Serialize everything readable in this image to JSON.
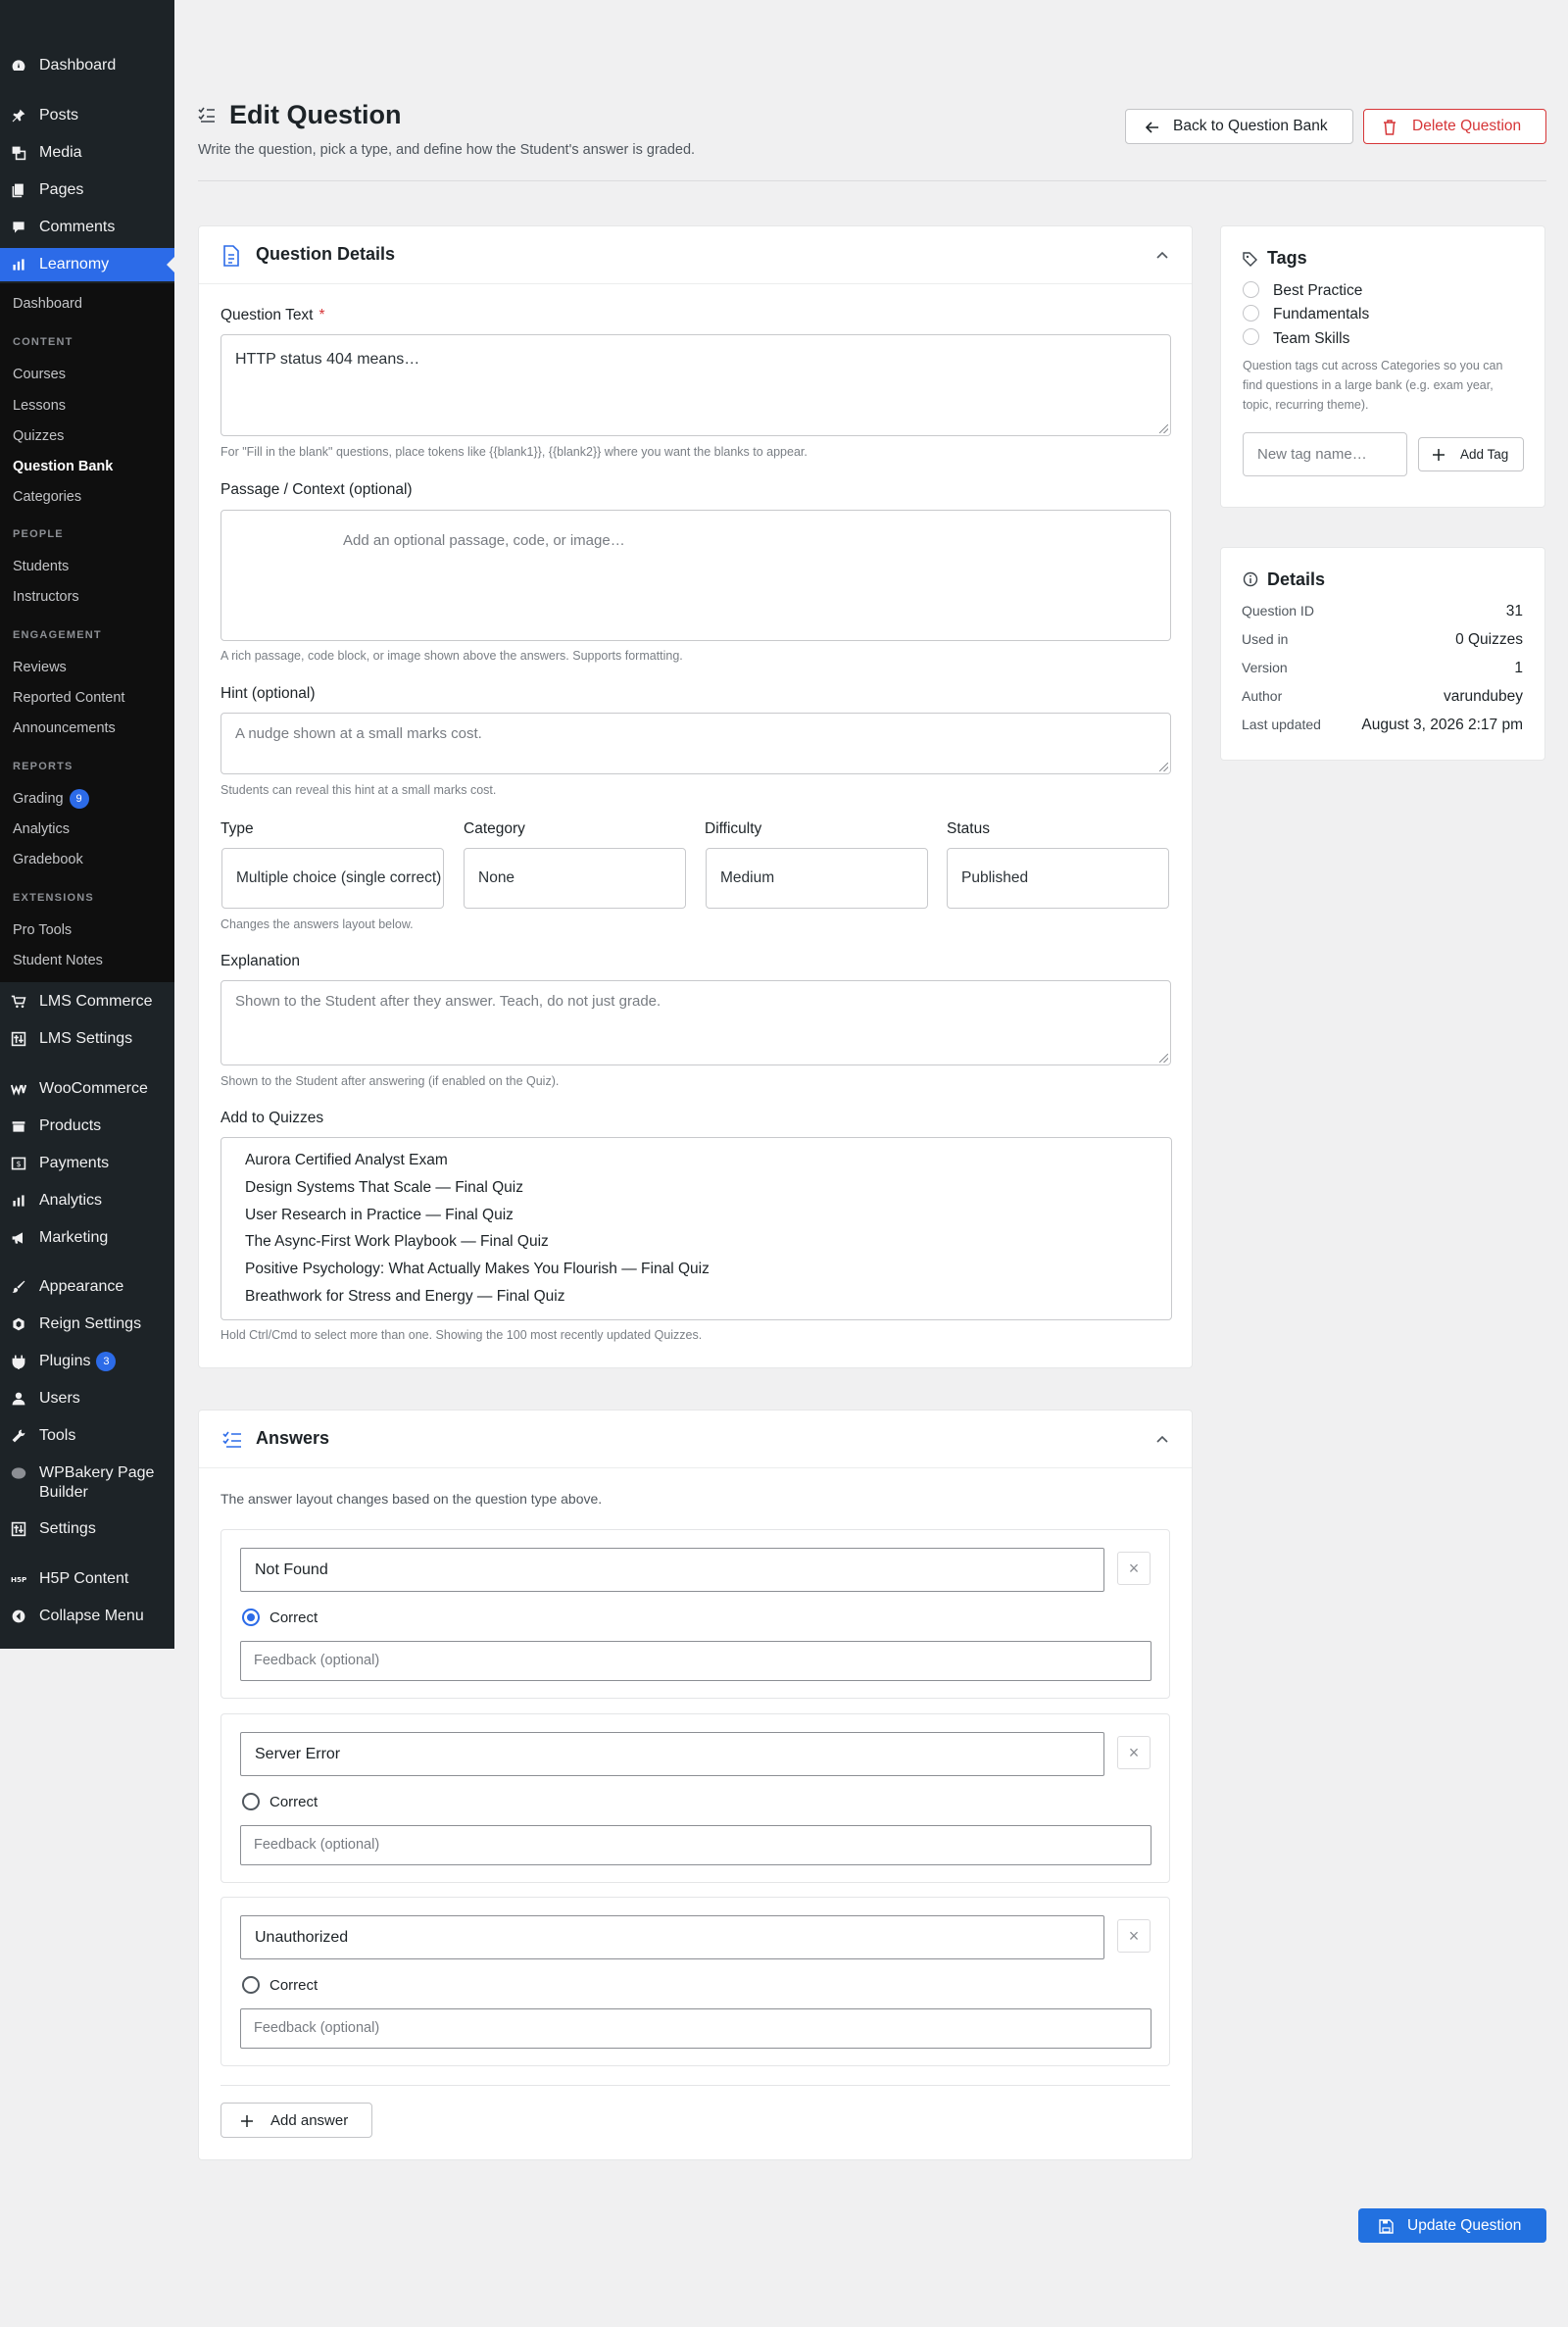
{
  "sidebar": {
    "top": [
      {
        "label": "Dashboard",
        "icon": "dashboard-icon"
      },
      {
        "label": "Posts",
        "icon": "pin-icon"
      },
      {
        "label": "Media",
        "icon": "media-icon"
      },
      {
        "label": "Pages",
        "icon": "pages-icon"
      },
      {
        "label": "Comments",
        "icon": "comments-icon"
      },
      {
        "label": "Learnomy",
        "icon": "chart-icon"
      }
    ],
    "sub": {
      "dashboard": "Dashboard",
      "content_header": "CONTENT",
      "courses": "Courses",
      "lessons": "Lessons",
      "quizzes": "Quizzes",
      "question_bank": "Question Bank",
      "categories": "Categories",
      "people_header": "PEOPLE",
      "students": "Students",
      "instructors": "Instructors",
      "engagement_header": "ENGAGEMENT",
      "reviews": "Reviews",
      "reported": "Reported Content",
      "announcements": "Announcements",
      "reports_header": "REPORTS",
      "grading": "Grading",
      "grading_count": "9",
      "analytics": "Analytics",
      "gradebook": "Gradebook",
      "extensions_header": "EXTENSIONS",
      "pro_tools": "Pro Tools",
      "student_notes": "Student Notes"
    },
    "bottom": [
      {
        "label": "LMS Commerce",
        "icon": "cart-icon"
      },
      {
        "label": "LMS Settings",
        "icon": "settings-grid-icon"
      },
      {
        "label": "WooCommerce",
        "icon": "woo-icon"
      },
      {
        "label": "Products",
        "icon": "products-icon"
      },
      {
        "label": "Payments",
        "icon": "payments-icon"
      },
      {
        "label": "Analytics",
        "icon": "bar-chart-icon"
      },
      {
        "label": "Marketing",
        "icon": "megaphone-icon"
      },
      {
        "label": "Appearance",
        "icon": "brush-icon"
      },
      {
        "label": "Reign Settings",
        "icon": "reign-icon"
      },
      {
        "label": "Plugins",
        "icon": "plugin-icon",
        "badge": "3"
      },
      {
        "label": "Users",
        "icon": "user-icon"
      },
      {
        "label": "Tools",
        "icon": "wrench-icon"
      },
      {
        "label": "WPBakery Page Builder",
        "icon": "wpbakery-icon"
      },
      {
        "label": "Settings",
        "icon": "settings-icon"
      },
      {
        "label": "H5P Content",
        "icon": "h5p-icon"
      },
      {
        "label": "Collapse Menu",
        "icon": "collapse-icon"
      }
    ]
  },
  "header": {
    "title": "Edit Question",
    "subtitle": "Write the question, pick a type, and define how the Student's answer is graded.",
    "back_button": "Back to Question Bank",
    "delete_button": "Delete Question"
  },
  "details_card": {
    "title": "Question Details",
    "question_text_label": "Question Text",
    "required_mark": "*",
    "question_text_value": "HTTP status 404 means…",
    "question_text_help": "For \"Fill in the blank\" questions, place tokens like {{blank1}}, {{blank2}} where you want the blanks to appear.",
    "passage_label": "Passage / Context (optional)",
    "passage_placeholder": "Add an optional passage, code, or image…",
    "passage_help": "A rich passage, code block, or image shown above the answers. Supports formatting.",
    "hint_label": "Hint (optional)",
    "hint_placeholder": "A nudge shown at a small marks cost.",
    "hint_help": "Students can reveal this hint at a small marks cost.",
    "type_label": "Type",
    "type_value": "Multiple choice (single correct)",
    "category_label": "Category",
    "category_value": "None",
    "difficulty_label": "Difficulty",
    "difficulty_value": "Medium",
    "status_label": "Status",
    "status_value": "Published",
    "type_help": "Changes the answers layout below.",
    "explanation_label": "Explanation",
    "explanation_placeholder": "Shown to the Student after they answer. Teach, do not just grade.",
    "explanation_help": "Shown to the Student after answering (if enabled on the Quiz).",
    "quizzes_label": "Add to Quizzes",
    "quizzes": [
      "Aurora Certified Analyst Exam",
      "Design Systems That Scale — Final Quiz",
      "User Research in Practice — Final Quiz",
      "The Async-First Work Playbook — Final Quiz",
      "Positive Psychology: What Actually Makes You Flourish — Final Quiz",
      "Breathwork for Stress and Energy — Final Quiz"
    ],
    "quizzes_help": "Hold Ctrl/Cmd to select more than one. Showing the 100 most recently updated Quizzes."
  },
  "answers_card": {
    "title": "Answers",
    "intro": "The answer layout changes based on the question type above.",
    "correct_label": "Correct",
    "feedback_placeholder": "Feedback (optional)",
    "remove_glyph": "×",
    "answers": [
      {
        "text": "Not Found",
        "correct": true
      },
      {
        "text": "Server Error",
        "correct": false
      },
      {
        "text": "Unauthorized",
        "correct": false
      }
    ],
    "add_button": "Add answer"
  },
  "tags_card": {
    "title": "Tags",
    "tags": [
      "Best Practice",
      "Fundamentals",
      "Team Skills"
    ],
    "help": "Question tags cut across Categories so you can find questions in a large bank (e.g. exam year, topic, recurring theme).",
    "new_tag_placeholder": "New tag name…",
    "add_tag_button": "Add Tag"
  },
  "info_card": {
    "title": "Details",
    "rows": [
      {
        "k": "Question ID",
        "v": "31"
      },
      {
        "k": "Used in",
        "v": "0 Quizzes"
      },
      {
        "k": "Version",
        "v": "1"
      },
      {
        "k": "Author",
        "v": "varundubey"
      },
      {
        "k": "Last updated",
        "v": "August 3, 2026 2:17 pm"
      }
    ]
  },
  "footer": {
    "update_button": "Update Question"
  },
  "colors": {
    "accent": "#2c6be8",
    "danger": "#d63638",
    "sidebar": "#1d2327",
    "submenu": "#0f0f0f",
    "primary_button": "#2271e0"
  }
}
